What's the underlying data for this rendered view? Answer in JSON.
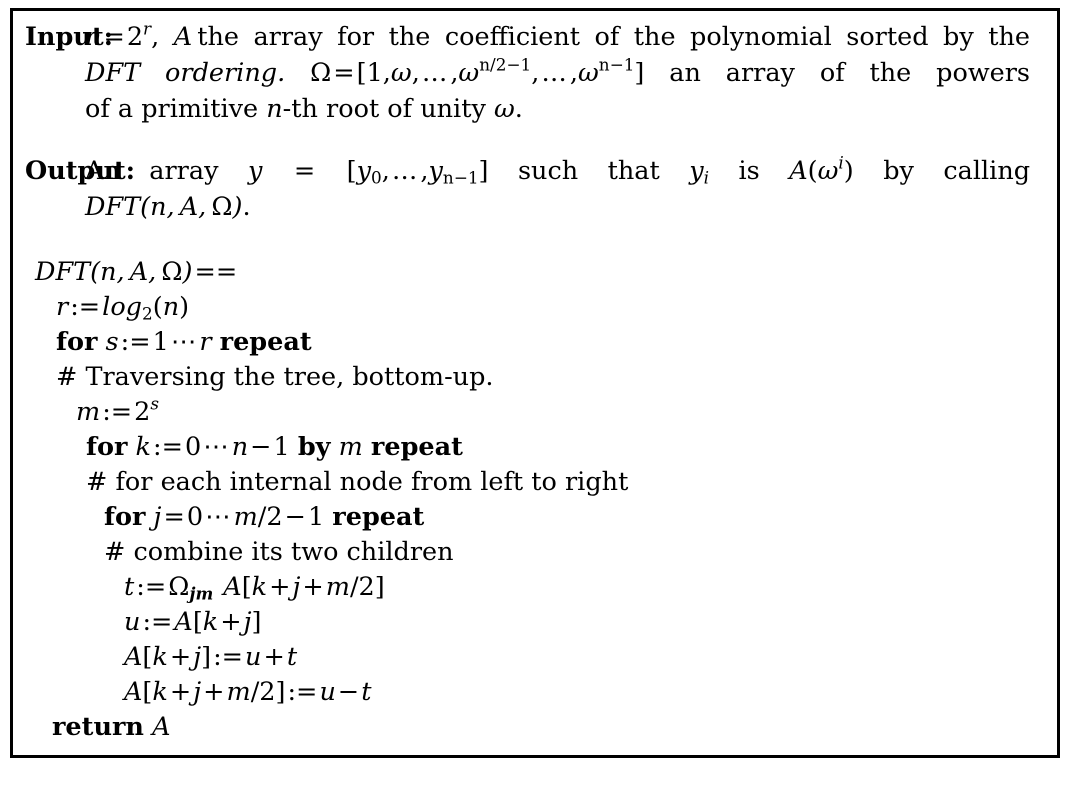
{
  "document": {
    "kind": "algorithm-box",
    "border_color": "#000000",
    "background_color": "#ffffff",
    "text_color": "#000000"
  },
  "input": {
    "label": "Input:",
    "text": "n = 2^r, A the array for the coefficient of the polynomial sorted by the DFT ordering. Ω = [1,ω,…,ω^{n/2−1},…,ω^{n−1}] an array of the powers of a primitive n-th root of unity ω.",
    "line1": {
      "var_n": "n",
      "eq": "=",
      "two": "2",
      "exp_r": "r",
      "comma": ", ",
      "var_A": "A",
      "words": "the array for the coefficient of the polynomial sorted by the"
    },
    "line2": {
      "dft_ordering": "DFT ordering.",
      "omega_cap": "Ω",
      "eq": "=",
      "lbrack": "[",
      "one": "1",
      "comma": ",",
      "omega": "ω",
      "dots": "…",
      "exp_half": "n/2−1",
      "exp_nm1": "n−1",
      "rbrack": "]",
      "words": "an array of the powers"
    },
    "line3": {
      "words_a": "of a primitive",
      "var_n": "n",
      "words_b": "-th root of unity",
      "omega": "ω",
      "period": "."
    }
  },
  "output": {
    "label": "Output:",
    "text": "An array y = [y_0,…,y_{n−1}] such that y_i is A(ω^i) by calling DFT(n, A, Ω).",
    "line1": {
      "an_array": "An array",
      "var_y": "y",
      "eq": "=",
      "lbrack": "[",
      "y0": "y",
      "sub0": "0",
      "comma": ",",
      "dots": "…",
      "yn": "y",
      "subn": "n−1",
      "rbrack": "]",
      "such_that": "such that",
      "yi": "y",
      "subi": "i",
      "is": "is",
      "A": "A",
      "lparen": "(",
      "omega": "ω",
      "exp_i": "i",
      "rparen": ")",
      "by_calling": "by calling"
    },
    "line2": {
      "DFT": "DFT",
      "args": "(n, A, Ω)",
      "n": "n",
      "A": "A",
      "omega": "Ω",
      "period": "."
    }
  },
  "code": {
    "lines": [
      {
        "id": "signature",
        "indent": 0,
        "text": "DFT(n, A, Ω) =="
      },
      {
        "id": "assign-r",
        "indent": 1,
        "text": "r := log2(n)"
      },
      {
        "id": "for-s",
        "indent": 1,
        "text": "for s := 1⋯r repeat"
      },
      {
        "id": "comment-traversing",
        "indent": 1,
        "text": "# Traversing the tree, bottom-up."
      },
      {
        "id": "assign-m",
        "indent": 2,
        "text": "m := 2^s"
      },
      {
        "id": "for-k",
        "indent": 3,
        "text": "for k := 0⋯n − 1 by m repeat"
      },
      {
        "id": "comment-internal-node",
        "indent": 3,
        "text": "# for each internal node from left to right"
      },
      {
        "id": "for-j",
        "indent": 4,
        "text": "for j = 0⋯m/2 − 1 repeat"
      },
      {
        "id": "comment-combine",
        "indent": 4,
        "text": "# combine its two children"
      },
      {
        "id": "assign-t",
        "indent": 5,
        "text": "t := Ωjm  A[k + j + m/2]"
      },
      {
        "id": "assign-u",
        "indent": 5,
        "text": "u := A[k + j]"
      },
      {
        "id": "assign-a-plus",
        "indent": 5,
        "text": "A[k + j] := u + t"
      },
      {
        "id": "assign-a-minus",
        "indent": 5,
        "text": "A[k + j + m/2] := u − t"
      },
      {
        "id": "return",
        "indent": 1,
        "text": "return A"
      }
    ],
    "tokens": {
      "DFT": "DFT",
      "log": "log",
      "log_sub": "2",
      "for": "for",
      "by": "by",
      "repeat": "repeat",
      "return": "return",
      "hash": "#",
      "comment_traversing": "Traversing the tree, bottom-up.",
      "comment_internal": "for each internal node from left to right",
      "comment_combine": "combine its two children",
      "assign": ":=",
      "equals": "=",
      "eqeq": "==",
      "cdots": "⋯",
      "plus": "+",
      "minus": "−",
      "two": "2",
      "one": "1",
      "zero": "0",
      "half": "/2",
      "var_r": "r",
      "var_s": "s",
      "var_m": "m",
      "var_k": "k",
      "var_j": "j",
      "var_n": "n",
      "var_t": "t",
      "var_u": "u",
      "var_A": "A",
      "omega_cap": "Ω",
      "sub_jm": "jm",
      "lparen": "(",
      "rparen": ")",
      "lbrack": "[",
      "rbrack": "]",
      "comma": ","
    }
  }
}
